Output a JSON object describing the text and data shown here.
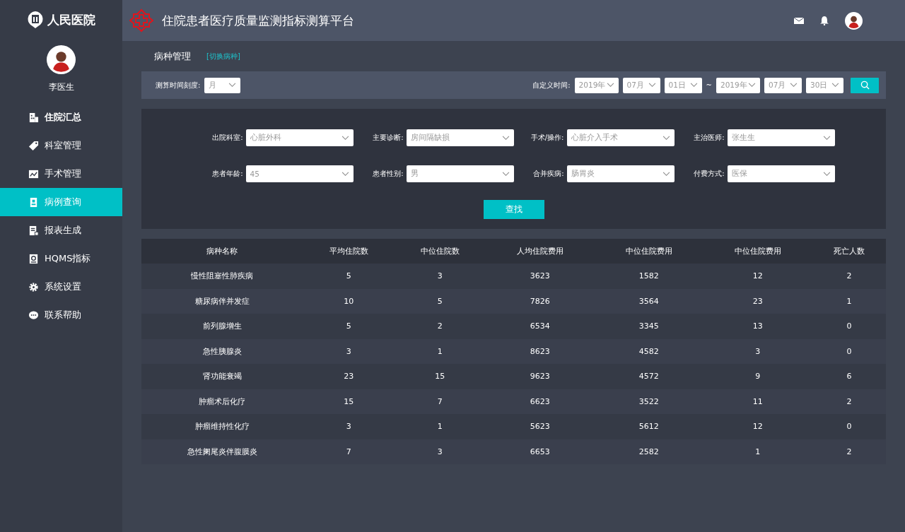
{
  "brand": {
    "name": "人民医院"
  },
  "user": {
    "name": "李医生"
  },
  "sidebar": {
    "items": [
      {
        "label": "住院汇总",
        "selected": false,
        "bold": true
      },
      {
        "label": "科室管理",
        "selected": false,
        "bold": false
      },
      {
        "label": "手术管理",
        "selected": false,
        "bold": false
      },
      {
        "label": "病例查询",
        "selected": true,
        "bold": false
      },
      {
        "label": "报表生成",
        "selected": false,
        "bold": false
      },
      {
        "label": "HQMS指标",
        "selected": false,
        "bold": false
      },
      {
        "label": "系统设置",
        "selected": false,
        "bold": false
      },
      {
        "label": "联系帮助",
        "selected": false,
        "bold": false
      }
    ]
  },
  "header": {
    "title": "住院患者医疗质量监测指标测算平台"
  },
  "page": {
    "title": "病种管理",
    "switch_link": "[切换病种]"
  },
  "time_bar": {
    "scale_label": "测算时间刻度:",
    "scale_value": "月",
    "custom_label": "自定义时间:",
    "from": [
      "2019年",
      "07月",
      "01日"
    ],
    "separator": "~",
    "to": [
      "2019年",
      "07月",
      "30日"
    ]
  },
  "filters": [
    {
      "label": "出院科室:",
      "value": "心脏外科"
    },
    {
      "label": "主要诊断:",
      "value": "房间隔缺损"
    },
    {
      "label": "手术/操作:",
      "value": "心脏介入手术"
    },
    {
      "label": "主治医师:",
      "value": "张生生"
    },
    {
      "label": "患者年龄:",
      "value": "45"
    },
    {
      "label": "患者性别:",
      "value": "男"
    },
    {
      "label": "合并疾病:",
      "value": "肠胃炎"
    },
    {
      "label": "付费方式:",
      "value": "医保"
    }
  ],
  "search_button": "查找",
  "table": {
    "columns": [
      "病种名称",
      "平均住院数",
      "中位住院数",
      "人均住院费用",
      "中位住院费用",
      "中位住院费用",
      "死亡人数"
    ],
    "rows": [
      [
        "慢性阻塞性肺疾病",
        "5",
        "3",
        "3623",
        "1582",
        "12",
        "2"
      ],
      [
        "糖尿病伴并发症",
        "10",
        "5",
        "7826",
        "3564",
        "23",
        "1"
      ],
      [
        "前列腺增生",
        "5",
        "2",
        "6534",
        "3345",
        "13",
        "0"
      ],
      [
        "急性胰腺炎",
        "3",
        "1",
        "8623",
        "4582",
        "3",
        "0"
      ],
      [
        "肾功能衰竭",
        "23",
        "15",
        "9623",
        "4572",
        "9",
        "6"
      ],
      [
        "肿瘤术后化疗",
        "15",
        "7",
        "6623",
        "3522",
        "11",
        "2"
      ],
      [
        "肿瘤维持性化疗",
        "3",
        "1",
        "5623",
        "5612",
        "12",
        "0"
      ],
      [
        "急性阑尾炎伴腹膜炎",
        "7",
        "3",
        "6653",
        "2582",
        "1",
        "2"
      ]
    ]
  }
}
